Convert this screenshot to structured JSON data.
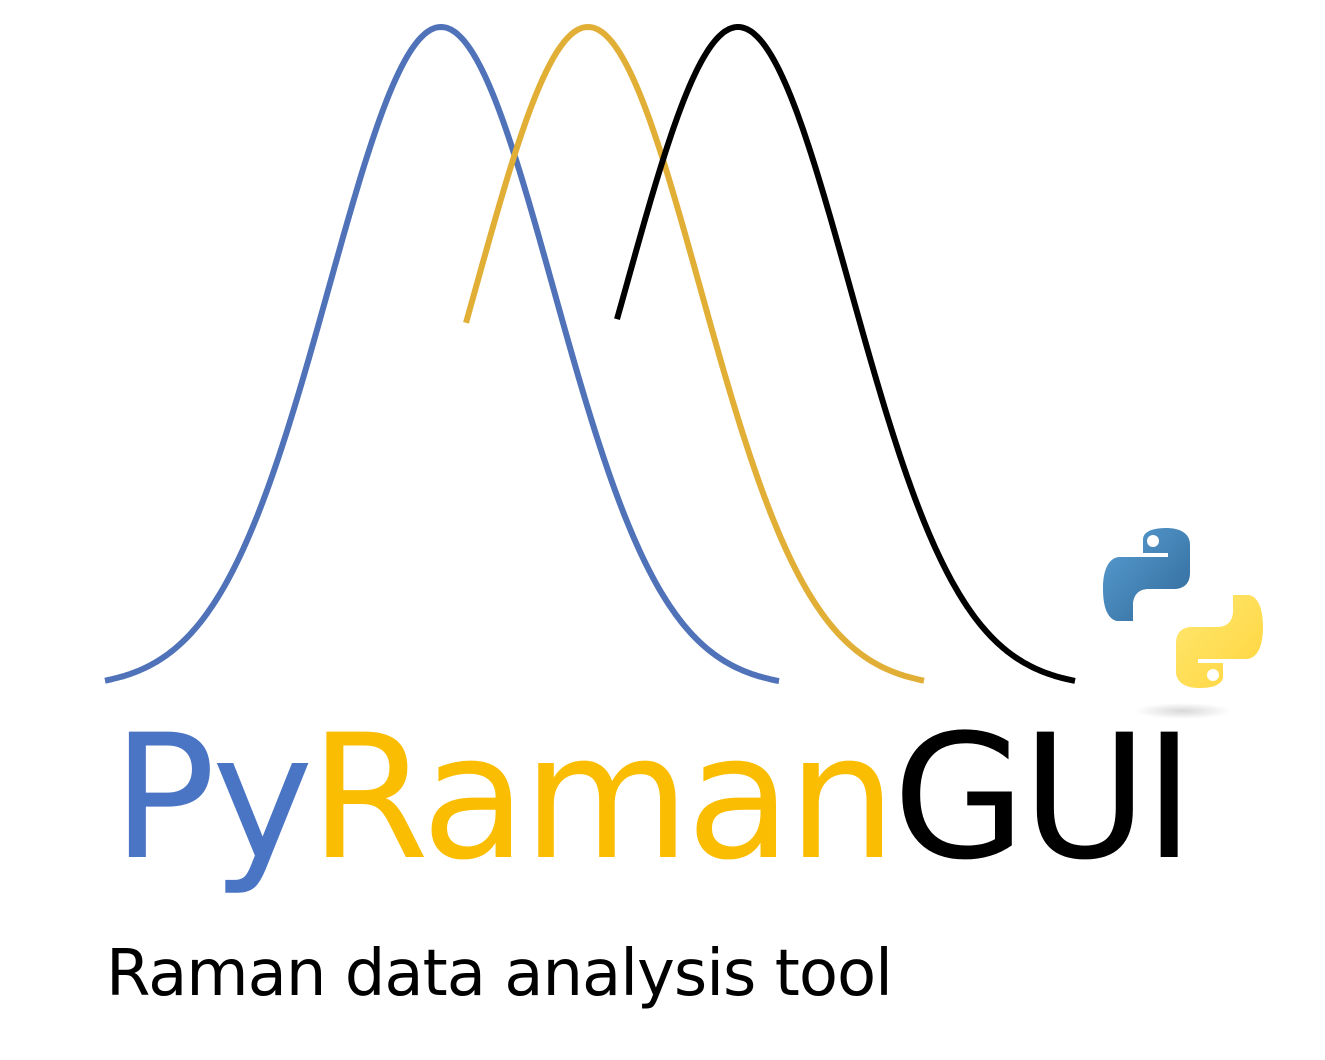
{
  "logo": {
    "title_parts": [
      "Py",
      "Raman",
      "GUI"
    ],
    "subtitle": "Raman data analysis tool",
    "colors": {
      "blue": "#4a74c4",
      "gold": "#fbbd01",
      "black": "#000000",
      "peak_blue": "#4f72b8",
      "peak_gold": "#e1ae36",
      "peak_black": "#000000"
    },
    "icons": [
      "raman-peaks-graphic",
      "python-logo-icon"
    ]
  }
}
